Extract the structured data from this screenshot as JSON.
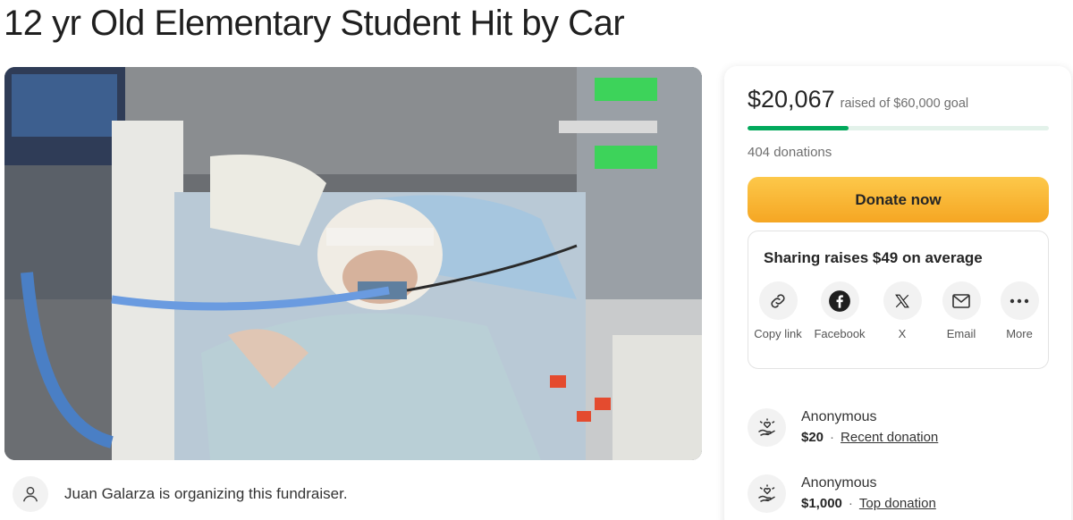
{
  "page": {
    "title": "12 yr Old Elementary Student Hit by Car"
  },
  "organizer": {
    "text": "Juan Galarza is organizing this fundraiser."
  },
  "donation_card": {
    "raised_amount": "$20,067",
    "raised_goal": "raised of $60,000 goal",
    "progress_fraction": 0.334,
    "donation_count": "404 donations",
    "donate_label": "Donate now",
    "share": {
      "title": "Sharing raises $49 on average",
      "buttons": [
        {
          "label": "Copy link",
          "icon": "link-icon"
        },
        {
          "label": "Facebook",
          "icon": "facebook-icon"
        },
        {
          "label": "X",
          "icon": "x-icon"
        },
        {
          "label": "Email",
          "icon": "email-icon"
        },
        {
          "label": "More",
          "icon": "more-icon"
        }
      ]
    },
    "donors": [
      {
        "name": "Anonymous",
        "amount": "$20",
        "tag": "Recent donation"
      },
      {
        "name": "Anonymous",
        "amount": "$1,000",
        "tag": "Top donation"
      }
    ]
  },
  "colors": {
    "accent_green": "#02a95c",
    "donate_button_top": "#fdc84a",
    "donate_button_bottom": "#f5a623"
  }
}
